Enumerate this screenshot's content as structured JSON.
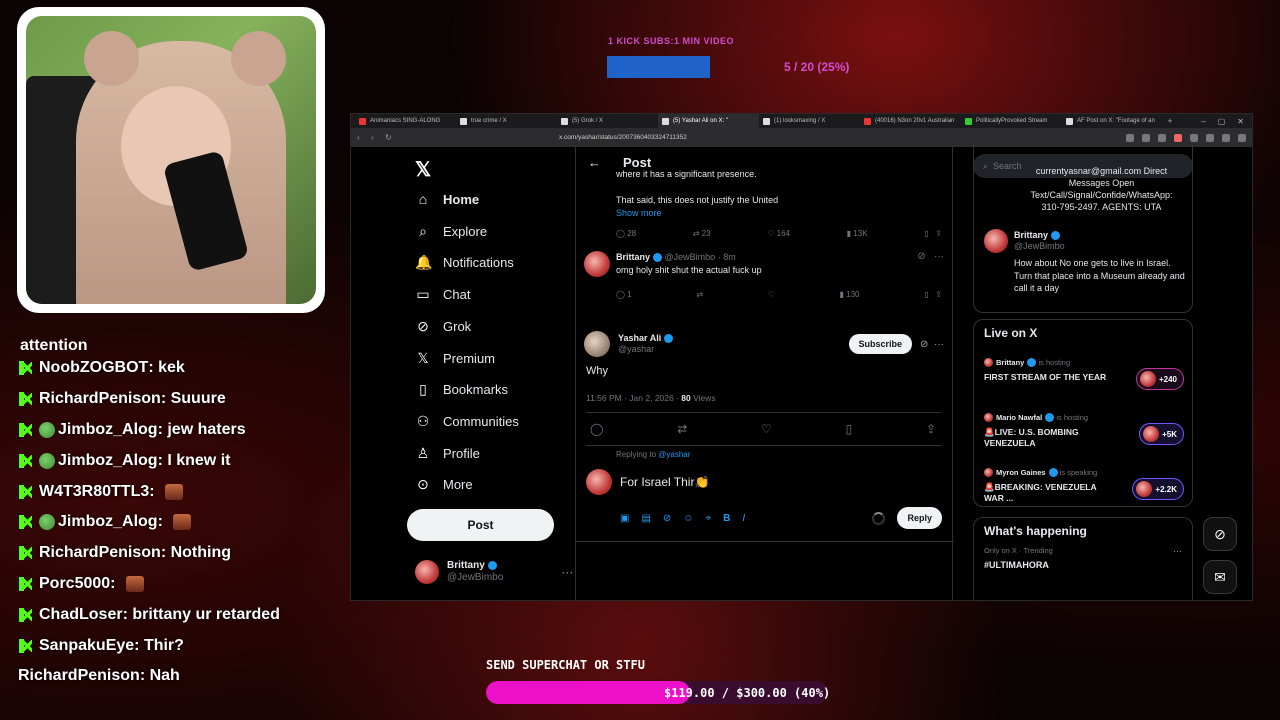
{
  "overlay": {
    "subs_goal": {
      "label": "1 KICK SUBS:1 MIN VIDEO",
      "progress_text": "5 / 20 (25%)",
      "progress_fraction": 0.25
    },
    "donation_goal": {
      "label": "SEND SUPERCHAT OR STFU",
      "progress_text": "$119.00 / $300.00 (40%)",
      "progress_fraction": 0.4
    },
    "chat_cut_text": "attention",
    "chat": [
      {
        "user": "NoobZOGBOT",
        "message": "kek",
        "badge": false,
        "emote": false
      },
      {
        "user": "RichardPenison",
        "message": "Suuure",
        "badge": false,
        "emote": false
      },
      {
        "user": "Jimboz_Alog",
        "message": "jew haters",
        "badge": true,
        "emote": false
      },
      {
        "user": "Jimboz_Alog",
        "message": "I knew it",
        "badge": true,
        "emote": false
      },
      {
        "user": "W4T3R80TTL3",
        "message": "",
        "badge": false,
        "emote": true
      },
      {
        "user": "Jimboz_Alog",
        "message": "",
        "badge": true,
        "emote": true
      },
      {
        "user": "RichardPenison",
        "message": "Nothing",
        "badge": false,
        "emote": false
      },
      {
        "user": "Porc5000",
        "message": "",
        "badge": false,
        "emote": true
      },
      {
        "user": "ChadLoser",
        "message": "brittany ur retarded",
        "badge": false,
        "emote": false
      },
      {
        "user": "SanpakuEye",
        "message": "Thir?",
        "badge": false,
        "emote": false
      },
      {
        "user": "RichardPenison",
        "message": "Nah",
        "badge": false,
        "emote": false,
        "no_icon": true
      }
    ]
  },
  "browser": {
    "tabs": [
      {
        "label": "Animaniacs SING-ALONG",
        "icon": "yt"
      },
      {
        "label": "true crime / X",
        "icon": "x"
      },
      {
        "label": "(5) Grok / X",
        "icon": "x"
      },
      {
        "label": "(5) Yashar Ali on X: \"",
        "icon": "x",
        "active": true
      },
      {
        "label": "(1) looksmaxing / X",
        "icon": "x"
      },
      {
        "label": "(40016) N3on 20v1 Australian",
        "icon": "yt"
      },
      {
        "label": "PoliticallyProvoked Stream",
        "icon": "g"
      },
      {
        "label": "AF Post on X: \"Footage of an",
        "icon": "x"
      }
    ],
    "url": "x.com/yashar/status/2007360403324711352"
  },
  "x": {
    "nav": [
      {
        "label": "Home",
        "icon": "home-icon",
        "glyph": "⌂"
      },
      {
        "label": "Explore",
        "icon": "search-icon",
        "glyph": "⌕"
      },
      {
        "label": "Notifications",
        "icon": "bell-icon",
        "glyph": "🔔"
      },
      {
        "label": "Chat",
        "icon": "chat-icon",
        "glyph": "▭"
      },
      {
        "label": "Grok",
        "icon": "grok-icon",
        "glyph": "⊘"
      },
      {
        "label": "Premium",
        "icon": "x-premium-icon",
        "glyph": "𝕏"
      },
      {
        "label": "Bookmarks",
        "icon": "bookmark-icon",
        "glyph": "▯"
      },
      {
        "label": "Communities",
        "icon": "communities-icon",
        "glyph": "⚇"
      },
      {
        "label": "Profile",
        "icon": "profile-icon",
        "glyph": "♙"
      },
      {
        "label": "More",
        "icon": "more-icon",
        "glyph": "⊙"
      }
    ],
    "post_button": "Post",
    "me": {
      "name": "Brittany",
      "handle": "@JewBimbo"
    },
    "header_title": "Post",
    "prev_tweet": {
      "line1": "where it has a significant presence.",
      "line2": "That said, this does not justify the United",
      "show_more": "Show more",
      "replies": "28",
      "reposts": "23",
      "likes": "164",
      "views": "13K"
    },
    "my_reply": {
      "name": "Brittany",
      "handle": "@JewBimbo",
      "time": "8m",
      "text": "omg holy shit shut the actual fuck up",
      "replies": "1",
      "views": "130"
    },
    "main_tweet": {
      "name": "Yashar Ali",
      "handle": "@yashar",
      "subscribe": "Subscribe",
      "text": "Why",
      "time": "11:56 PM · Jan 2, 2026 · ",
      "views_count": "80",
      "views_label": " Views"
    },
    "replying_to": {
      "prefix": "Replying to ",
      "handle": "@yashar"
    },
    "compose_text": "For Israel Thir👏",
    "reply_button": "Reply",
    "sidebar": {
      "search_placeholder": "Search",
      "bio_lines": [
        "currentyasnar@gmail.com Direct",
        "Messages Open",
        "Text/Call/Signal/Confide/WhatsApp:",
        "310-795-2497. AGENTS: UTA"
      ],
      "user": {
        "name": "Brittany",
        "handle": "@JewBimbo"
      },
      "user_post": "How about No one gets to live in Israel. Turn that place into a Museum already and call it a day",
      "live_title": "Live on X",
      "live": [
        {
          "host": "Brittany",
          "status": "is hosting",
          "title": "FIRST STREAM OF THE YEAR",
          "count": "+240",
          "color": "pink"
        },
        {
          "host": "Mario Nawfal",
          "status": "is hosting",
          "title": "🚨LIVE: U.S. BOMBING VENEZUELA",
          "count": "+5K",
          "color": "blue"
        },
        {
          "host": "Myron Gaines",
          "status": "is speaking",
          "title": "🚨BREAKING: VENEZUELA WAR ...",
          "count": "+2.2K",
          "color": "blue"
        }
      ],
      "happening_title": "What's happening",
      "trend_meta": "Only on X · Trending",
      "trend_name": "#ULTIMAHORA"
    }
  }
}
